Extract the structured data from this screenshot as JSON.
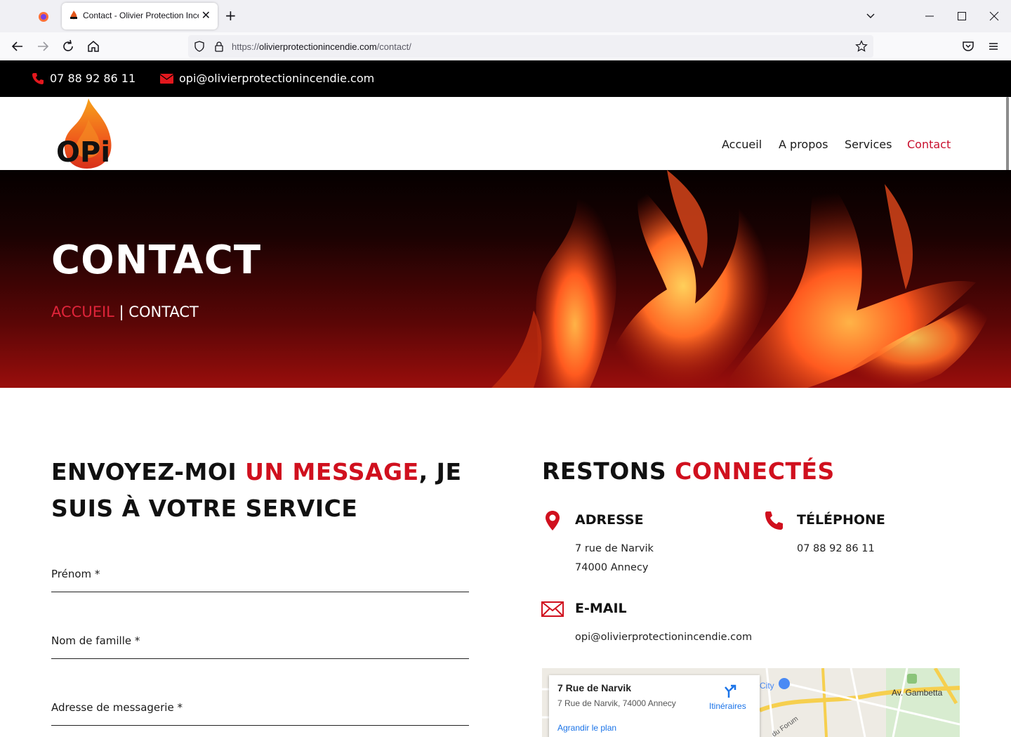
{
  "browser": {
    "tab_title": "Contact - Olivier Protection Incendie",
    "url_prefix": "https://",
    "url_domain": "olivierprotectionincendie.com",
    "url_path": "/contact/",
    "close_glyph": "✕",
    "newtab_glyph": "+"
  },
  "topbar": {
    "phone": "07 88 92 86 11",
    "email": "opi@olivierprotectionincendie.com"
  },
  "logo": {
    "text": "OPi"
  },
  "menu": {
    "items": [
      {
        "label": "Accueil"
      },
      {
        "label": "A propos"
      },
      {
        "label": "Services"
      },
      {
        "label": "Contact"
      }
    ],
    "active_color": "#c8102e"
  },
  "hero": {
    "title": "CONTACT",
    "breadcrumb_home": "ACCUEIL",
    "breadcrumb_sep": " | ",
    "breadcrumb_current": "CONTACT"
  },
  "form": {
    "heading_part1": "ENVOYEZ-MOI ",
    "heading_accent": "UN MESSAGE",
    "heading_part2": ", JE SUIS À VOTRE SERVICE",
    "fields": [
      {
        "label": "Prénom *"
      },
      {
        "label": "Nom de famille *"
      },
      {
        "label": "Adresse de messagerie *"
      }
    ]
  },
  "contact": {
    "heading_part1": "RESTONS ",
    "heading_accent": "CONNECTÉS",
    "address_title": "ADRESSE",
    "address_line1": "7 rue de Narvik",
    "address_line2": "74000 Annecy",
    "phone_title": "TÉLÉPHONE",
    "phone_value": "07 88 92 86 11",
    "email_title": "E-MAIL",
    "email_value": "opi@olivierprotectionincendie.com"
  },
  "map": {
    "place_name": "7 Rue de Narvik",
    "place_address": "7 Rue de Narvik, 74000 Annecy",
    "directions_label": "Itinéraires",
    "enlarge_label": "Agrandir le plan",
    "label_city": "City",
    "label_gambetta": "Av. Gambetta",
    "label_forum": "du Forum"
  },
  "colors": {
    "accent_red": "#d0101e",
    "topbar_bg": "#000000"
  }
}
